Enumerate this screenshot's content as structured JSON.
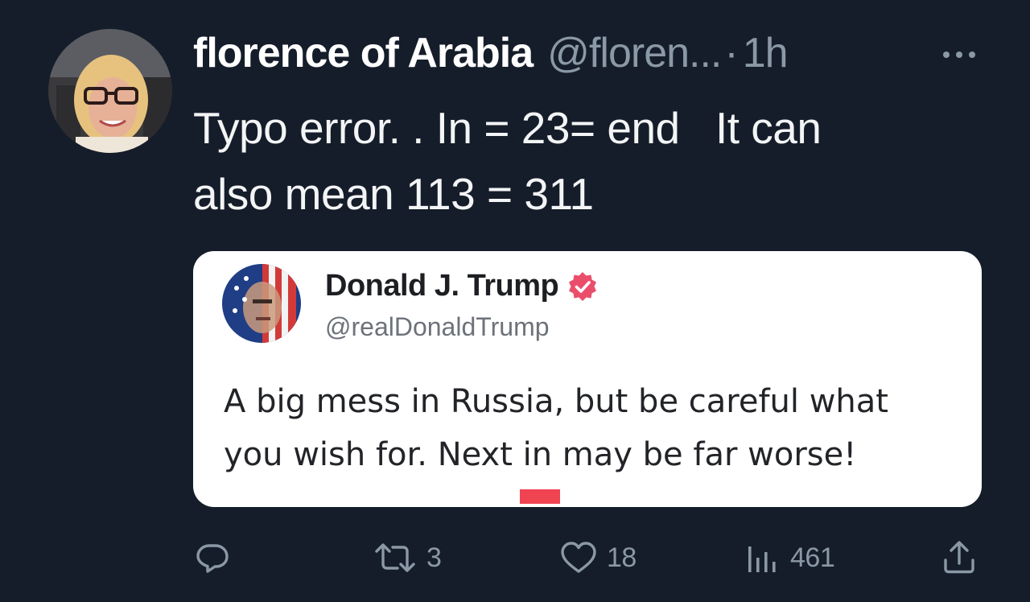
{
  "tweet": {
    "author": {
      "display_name": "florence of Arabia",
      "handle": "@floren...",
      "avatar_icon": "user-avatar-photo"
    },
    "separator": "·",
    "timestamp": "1h",
    "more_icon": "more-horizontal-icon",
    "text_lines": [
      "Typo error. . In = 23= end   It can",
      "also mean 113 = 311"
    ]
  },
  "quoted_post": {
    "name": "Donald J. Trump",
    "handle": "@realDonaldTrump",
    "verified_color": "#ea4e6b",
    "avatar_icon": "flag-portrait-avatar",
    "text_line_1": "A big mess in Russia, but be careful what",
    "text_line_2_before": "you wish for. Next ",
    "text_line_2_highlight": "in",
    "text_line_2_after": " may be far worse!",
    "highlight_color": "#f04453"
  },
  "actions": {
    "reply": {
      "icon": "reply-icon",
      "count": ""
    },
    "repost": {
      "icon": "repost-icon",
      "count": "3"
    },
    "like": {
      "icon": "heart-icon",
      "count": "18"
    },
    "views": {
      "icon": "analytics-icon",
      "count": "461"
    },
    "share": {
      "icon": "share-icon"
    }
  },
  "colors": {
    "background": "#151d2a",
    "muted_text": "#8b98a5",
    "primary_text": "#e7e9ea"
  }
}
